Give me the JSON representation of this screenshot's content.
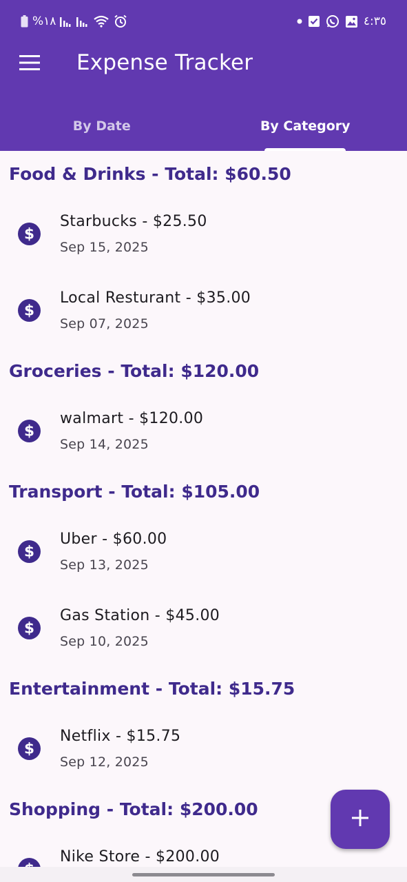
{
  "status_bar": {
    "battery_percent": "%١٨",
    "time": "٤:٣٥",
    "left_icons": [
      "battery-icon",
      "signal-icon",
      "signal-icon",
      "wifi-icon",
      "alarm-icon"
    ],
    "right_icons": [
      "dot-icon",
      "checkbox-icon",
      "whatsapp-icon",
      "gallery-icon"
    ]
  },
  "app_bar": {
    "title": "Expense Tracker",
    "menu_icon": "hamburger-menu-icon",
    "background": "#6139b0"
  },
  "tabs": [
    {
      "label": "By Date",
      "active": false
    },
    {
      "label": "By Category",
      "active": true
    }
  ],
  "groups": [
    {
      "header": "Food & Drinks - Total: $60.50",
      "items": [
        {
          "title": "Starbucks - $25.50",
          "date": "Sep 15, 2025",
          "icon": "dollar-icon"
        },
        {
          "title": "Local Resturant - $35.00",
          "date": "Sep 07, 2025",
          "icon": "dollar-icon"
        }
      ]
    },
    {
      "header": "Groceries - Total: $120.00",
      "items": [
        {
          "title": "walmart - $120.00",
          "date": "Sep 14, 2025",
          "icon": "dollar-icon"
        }
      ]
    },
    {
      "header": "Transport - Total: $105.00",
      "items": [
        {
          "title": "Uber - $60.00",
          "date": "Sep 13, 2025",
          "icon": "dollar-icon"
        },
        {
          "title": "Gas Station - $45.00",
          "date": "Sep 10, 2025",
          "icon": "dollar-icon"
        }
      ]
    },
    {
      "header": "Entertainment - Total: $15.75",
      "items": [
        {
          "title": "Netflix - $15.75",
          "date": "Sep 12, 2025",
          "icon": "dollar-icon"
        }
      ]
    },
    {
      "header": "Shopping - Total: $200.00",
      "items": [
        {
          "title": "Nike Store - $200.00",
          "date": "",
          "icon": "dollar-icon"
        }
      ]
    }
  ],
  "fab": {
    "icon": "plus-icon"
  },
  "colors": {
    "primary": "#6139b0",
    "group_header": "#3f2a8c",
    "background": "#fcf7fb"
  }
}
